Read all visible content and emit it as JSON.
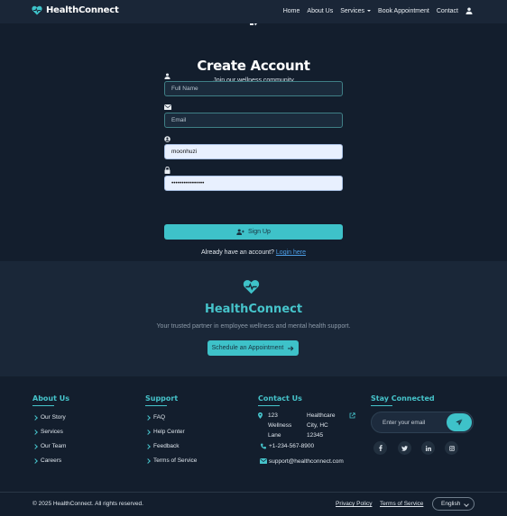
{
  "nav": {
    "brand": "HealthConnect",
    "links": [
      "Home",
      "About Us",
      "Services",
      "Book Appointment",
      "Contact"
    ]
  },
  "form": {
    "title": "Create Account",
    "subtitle": "Join our wellness community",
    "full_name_placeholder": "Full Name",
    "email_placeholder": "Email",
    "username_value": "moonhuzi",
    "password_value": "••••••••••••••••",
    "signup_label": "Sign Up",
    "login_prompt": "Already have an account?",
    "login_link": "Login here"
  },
  "hero": {
    "title": "HealthConnect",
    "tagline": "Your trusted partner in employee wellness and mental health support.",
    "cta": "Schedule an Appointment"
  },
  "footer": {
    "about": {
      "heading": "About Us",
      "links": [
        "Our Story",
        "Services",
        "Our Team",
        "Careers"
      ]
    },
    "support": {
      "heading": "Support",
      "links": [
        "FAQ",
        "Help Center",
        "Feedback",
        "Terms of Service"
      ]
    },
    "contact": {
      "heading": "Contact Us",
      "address_street": "123 Wellness Lane",
      "address_city": "Healthcare City, HC 12345",
      "phone": "+1-234-567-8900",
      "email": "support@healthconnect.com"
    },
    "stay": {
      "heading": "Stay Connected",
      "email_placeholder": "Enter your email"
    },
    "copyright": "© 2025 HealthConnect. All rights reserved.",
    "privacy": "Privacy Policy",
    "terms": "Terms of Service",
    "language": "English"
  },
  "colors": {
    "accent": "#3ec2c9",
    "background": "#131e2d",
    "link": "#4d9fe8"
  }
}
